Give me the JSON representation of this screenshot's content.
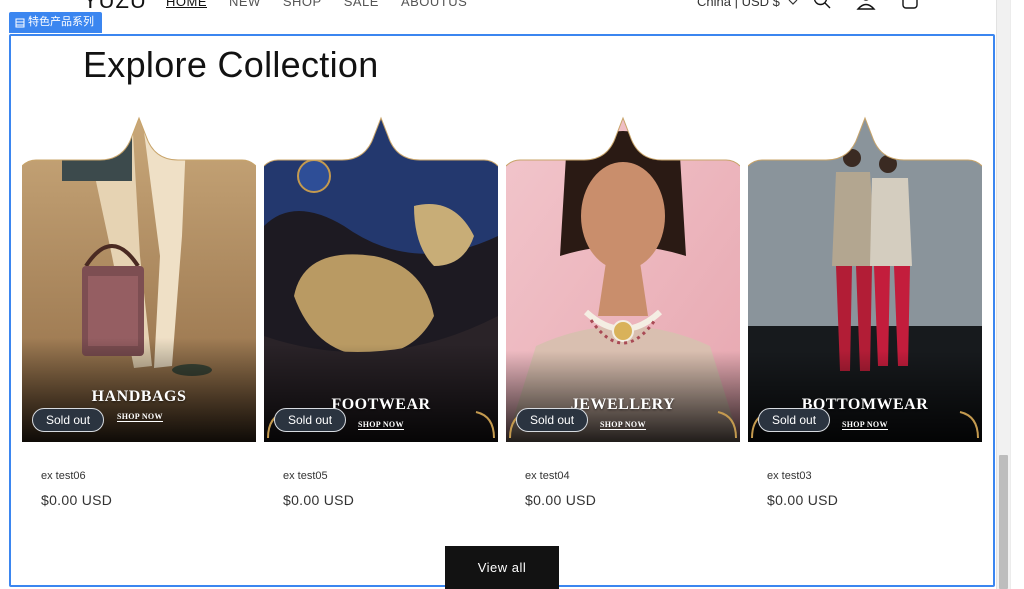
{
  "header": {
    "logo": "YUZU",
    "nav": [
      "HOME",
      "NEW",
      "SHOP",
      "SALE",
      "ABOUTUS"
    ],
    "country_selector": "China | USD $"
  },
  "editor_tag": "特色产品系列",
  "section": {
    "title": "Explore Collection",
    "view_all": "View all"
  },
  "products": [
    {
      "category": "HANDBAGS",
      "shop_now": "SHOP NOW",
      "badge": "Sold out",
      "title": "ex test06",
      "price": "$0.00 USD"
    },
    {
      "category": "FOOTWEAR",
      "shop_now": "SHOP NOW",
      "badge": "Sold out",
      "title": "ex test05",
      "price": "$0.00 USD"
    },
    {
      "category": "JEWELLERY",
      "shop_now": "SHOP NOW",
      "badge": "Sold out",
      "title": "ex test04",
      "price": "$0.00 USD"
    },
    {
      "category": "BOTTOMWEAR",
      "shop_now": "SHOP NOW",
      "badge": "Sold out",
      "title": "ex test03",
      "price": "$0.00 USD"
    }
  ],
  "colors": {
    "selection": "#3b86f0",
    "button": "#121212",
    "badge": "#2b3440"
  }
}
